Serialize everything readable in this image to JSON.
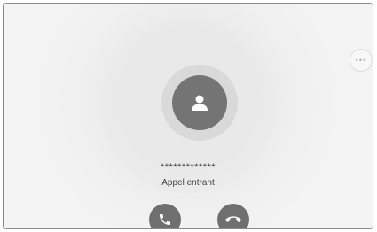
{
  "caller": {
    "number_masked": "*************",
    "status": "Appel entrant"
  },
  "icons": {
    "avatar": "person-icon",
    "more": "more-options-icon",
    "answer": "phone-answer-icon",
    "decline": "phone-hangup-icon"
  },
  "more_label": "•••",
  "colors": {
    "background": "#f2f2f2",
    "button": "#6f6f6f",
    "avatar": "#747474",
    "halo": "#d9d9d9"
  }
}
